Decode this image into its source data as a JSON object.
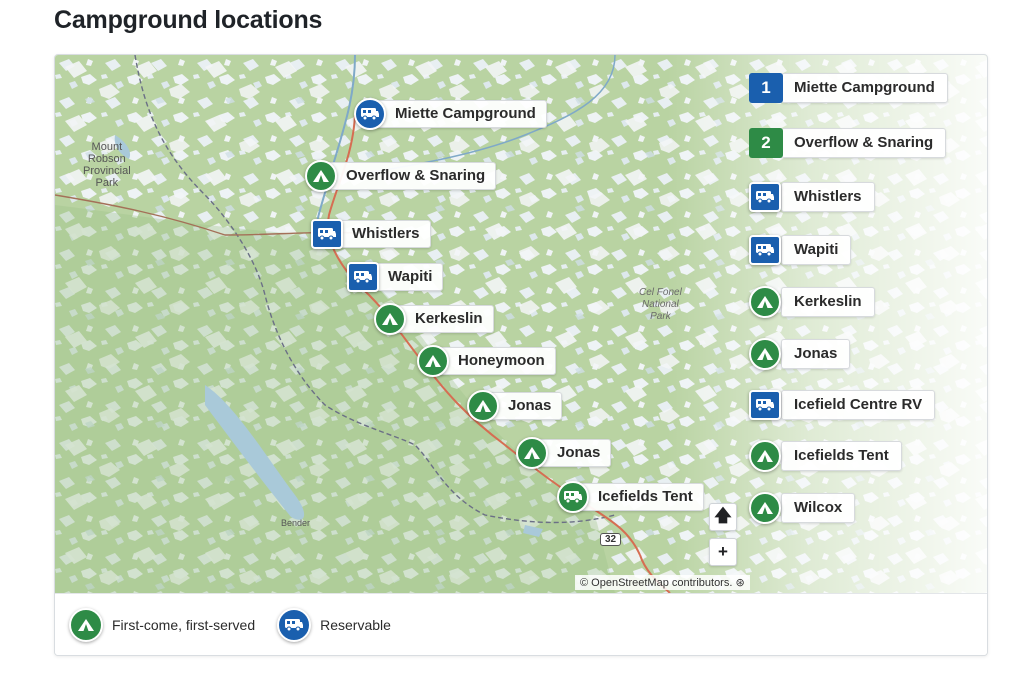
{
  "page": {
    "title": "Campground locations"
  },
  "map": {
    "place_labels": {
      "park_left": [
        "Mount",
        "Robson",
        "Provincial",
        "Park"
      ],
      "park_right": [
        "Cel Fonel",
        "National",
        "Park"
      ],
      "town": "Bender"
    },
    "road_shield": "32",
    "attribution": "© OpenStreetMap contributors. ⊛",
    "controls": {
      "north_up": "🡅",
      "zoom_in": "+"
    },
    "markers": [
      {
        "label": "Miette Campground",
        "type": "rv"
      },
      {
        "label": "Overflow & Snaring",
        "type": "tent"
      },
      {
        "label": "Whistlers",
        "type": "rv-sq"
      },
      {
        "label": "Wapiti",
        "type": "rv-sq"
      },
      {
        "label": "Kerkeslin",
        "type": "tent"
      },
      {
        "label": "Honeymoon",
        "type": "tent"
      },
      {
        "label": "Jonas",
        "type": "tent"
      },
      {
        "label": "Jonas",
        "type": "tent"
      },
      {
        "label": "Icefields Tent",
        "type": "rv"
      }
    ],
    "list": [
      {
        "badge": "1",
        "badge_color": "blue",
        "label": "Miette Campground"
      },
      {
        "badge": "2",
        "badge_color": "green",
        "label": "Overflow & Snaring"
      },
      {
        "icon": "rv-icon",
        "label": "Whistlers"
      },
      {
        "icon": "rv-icon",
        "label": "Wapiti"
      },
      {
        "icon": "tent-icon",
        "label": "Kerkeslin"
      },
      {
        "icon": "tent-icon",
        "label": "Jonas"
      },
      {
        "icon": "rv-icon",
        "label": "Icefield Centre RV"
      },
      {
        "icon": "tent-icon",
        "label": "Icefields Tent"
      },
      {
        "icon": "tent-icon",
        "label": "Wilcox"
      }
    ]
  },
  "legend": {
    "tent_label": "First-come, first-served",
    "rv_label": "Reservable"
  },
  "colors": {
    "tent_green": "#2e8b46",
    "rv_blue": "#1a5fae"
  }
}
